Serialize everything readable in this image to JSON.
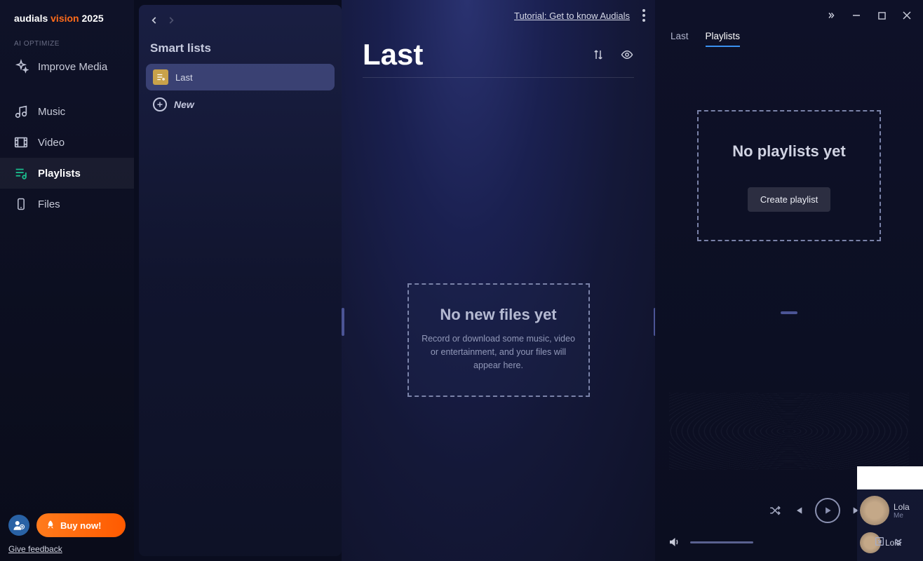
{
  "app": {
    "logo_a": "audials",
    "logo_b": "vision",
    "logo_c": "2025"
  },
  "nav": {
    "section_label": "AI OPTIMIZE",
    "improve_media": "Improve Media",
    "music": "Music",
    "video": "Video",
    "playlists": "Playlists",
    "files": "Files"
  },
  "footer": {
    "buy_now": "Buy now!",
    "feedback": "Give feedback"
  },
  "smart_panel": {
    "heading": "Smart lists",
    "item_last": "Last",
    "item_new": "New"
  },
  "main": {
    "tutorial_link": "Tutorial: Get to know Audials",
    "page_title": "Last",
    "empty_title": "No new files yet",
    "empty_sub": "Record or download some music, video or entertainment, and your files will appear here."
  },
  "right": {
    "tab_last": "Last",
    "tab_playlists": "Playlists",
    "pl_empty_title": "No playlists yet",
    "create_playlist": "Create playlist",
    "track_peek_title": "Lola",
    "track_peek_sub": "Me",
    "track_peek_title2": "Lola"
  }
}
